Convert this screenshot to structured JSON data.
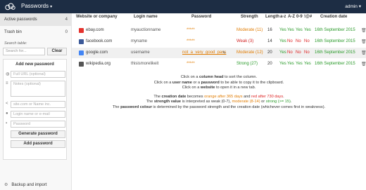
{
  "app": {
    "title": "Passwords",
    "caret": "▾",
    "user": "admin ▾"
  },
  "sidebar": {
    "items": [
      {
        "label": "Active passwords",
        "count": "4"
      },
      {
        "label": "Trash bin",
        "count": "0"
      }
    ],
    "search_label": "Search table:",
    "search_placeholder": "Search for...",
    "clear_label": "Clear",
    "add_panel": {
      "title": "Add new password",
      "url_placeholder": "Full URL (optional)",
      "notes_placeholder": "Notes (optional)",
      "site_placeholder": "site.com or Name inc.",
      "login_placeholder": "Login name or e-mail",
      "password_placeholder": "Password",
      "generate_label": "Generate password",
      "add_label": "Add password"
    },
    "backup_label": "Backup and import"
  },
  "table": {
    "headers": {
      "website": "Website or company",
      "login": "Login name",
      "password": "Password",
      "strength": "Strength",
      "length": "Length",
      "lower": "a-z",
      "upper": "A-Z",
      "digits": "0-9",
      "special": "!@#",
      "date": "Creation date"
    },
    "rows": [
      {
        "site": "ebay.com",
        "login": "myauctionname",
        "password": "*****",
        "strength": "Moderate (11)",
        "strength_color": "#e07b00",
        "length": "16",
        "lower": "Yes",
        "upper": "Yes",
        "digits": "Yes",
        "special": "Yes",
        "date": "16th September 2015",
        "favicon_color": "#e5322d"
      },
      {
        "site": "facebook.com",
        "login": "myname",
        "password": "*****",
        "strength": "Weak (3)",
        "strength_color": "#d22222",
        "length": "14",
        "lower": "Yes",
        "upper": "No",
        "digits": "No",
        "special": "No",
        "date": "16th September 2015",
        "favicon_color": "#3b5998"
      },
      {
        "site": "google.com",
        "login": "username",
        "password": "not_a_very_good_pass",
        "strength": "Moderate (12)",
        "strength_color": "#e07b00",
        "length": "20",
        "lower": "Yes",
        "upper": "No",
        "digits": "No",
        "special": "No",
        "date": "16th September 2015",
        "favicon_color": "#4285f4"
      },
      {
        "site": "wikipedia.org",
        "login": "thisismorelikeit",
        "password": "*****",
        "strength": "Strong (27)",
        "strength_color": "#2a9a2a",
        "length": "20",
        "lower": "Yes",
        "upper": "Yes",
        "digits": "Yes",
        "special": "Yes",
        "date": "16th September 2015",
        "favicon_color": "#555555"
      }
    ]
  },
  "info": {
    "line1_a": "Click on a ",
    "line1_b": "column head",
    "line1_c": " to sort the column.",
    "line2_a": "Click on a ",
    "line2_b": "user name",
    "line2_c": " or a ",
    "line2_d": "password",
    "line2_e": " to be able to copy it to the clipboard.",
    "line3_a": "Click on a ",
    "line3_b": "website",
    "line3_c": " to open it in a new tab.",
    "line4_a": "The ",
    "line4_b": "creation date",
    "line4_c": " becomes ",
    "line4_d": "orange after 365 days",
    "line4_e": " and ",
    "line4_f": "red after 730 days",
    "line4_g": ".",
    "line5_a": "The ",
    "line5_b": "strength value",
    "line5_c": " is interpreted as weak (0-7), ",
    "line5_d": "moderate (8-14)",
    "line5_e": " or ",
    "line5_f": "strong (>= 15)",
    "line5_g": ".",
    "line6_a": "The ",
    "line6_b": "password colour",
    "line6_c": " is determined by the password strength and the creation date (whichever comes first in weakness)."
  },
  "colors": {
    "topbar": "#1d2d44",
    "orange": "#e07b00",
    "red": "#d22222",
    "green": "#2a9a2a"
  },
  "icons": [
    "owncloud-logo",
    "globe-icon",
    "notes-icon",
    "share-icon",
    "user-icon",
    "lock-icon",
    "edit-icon",
    "trash-icon",
    "settings-icon"
  ]
}
